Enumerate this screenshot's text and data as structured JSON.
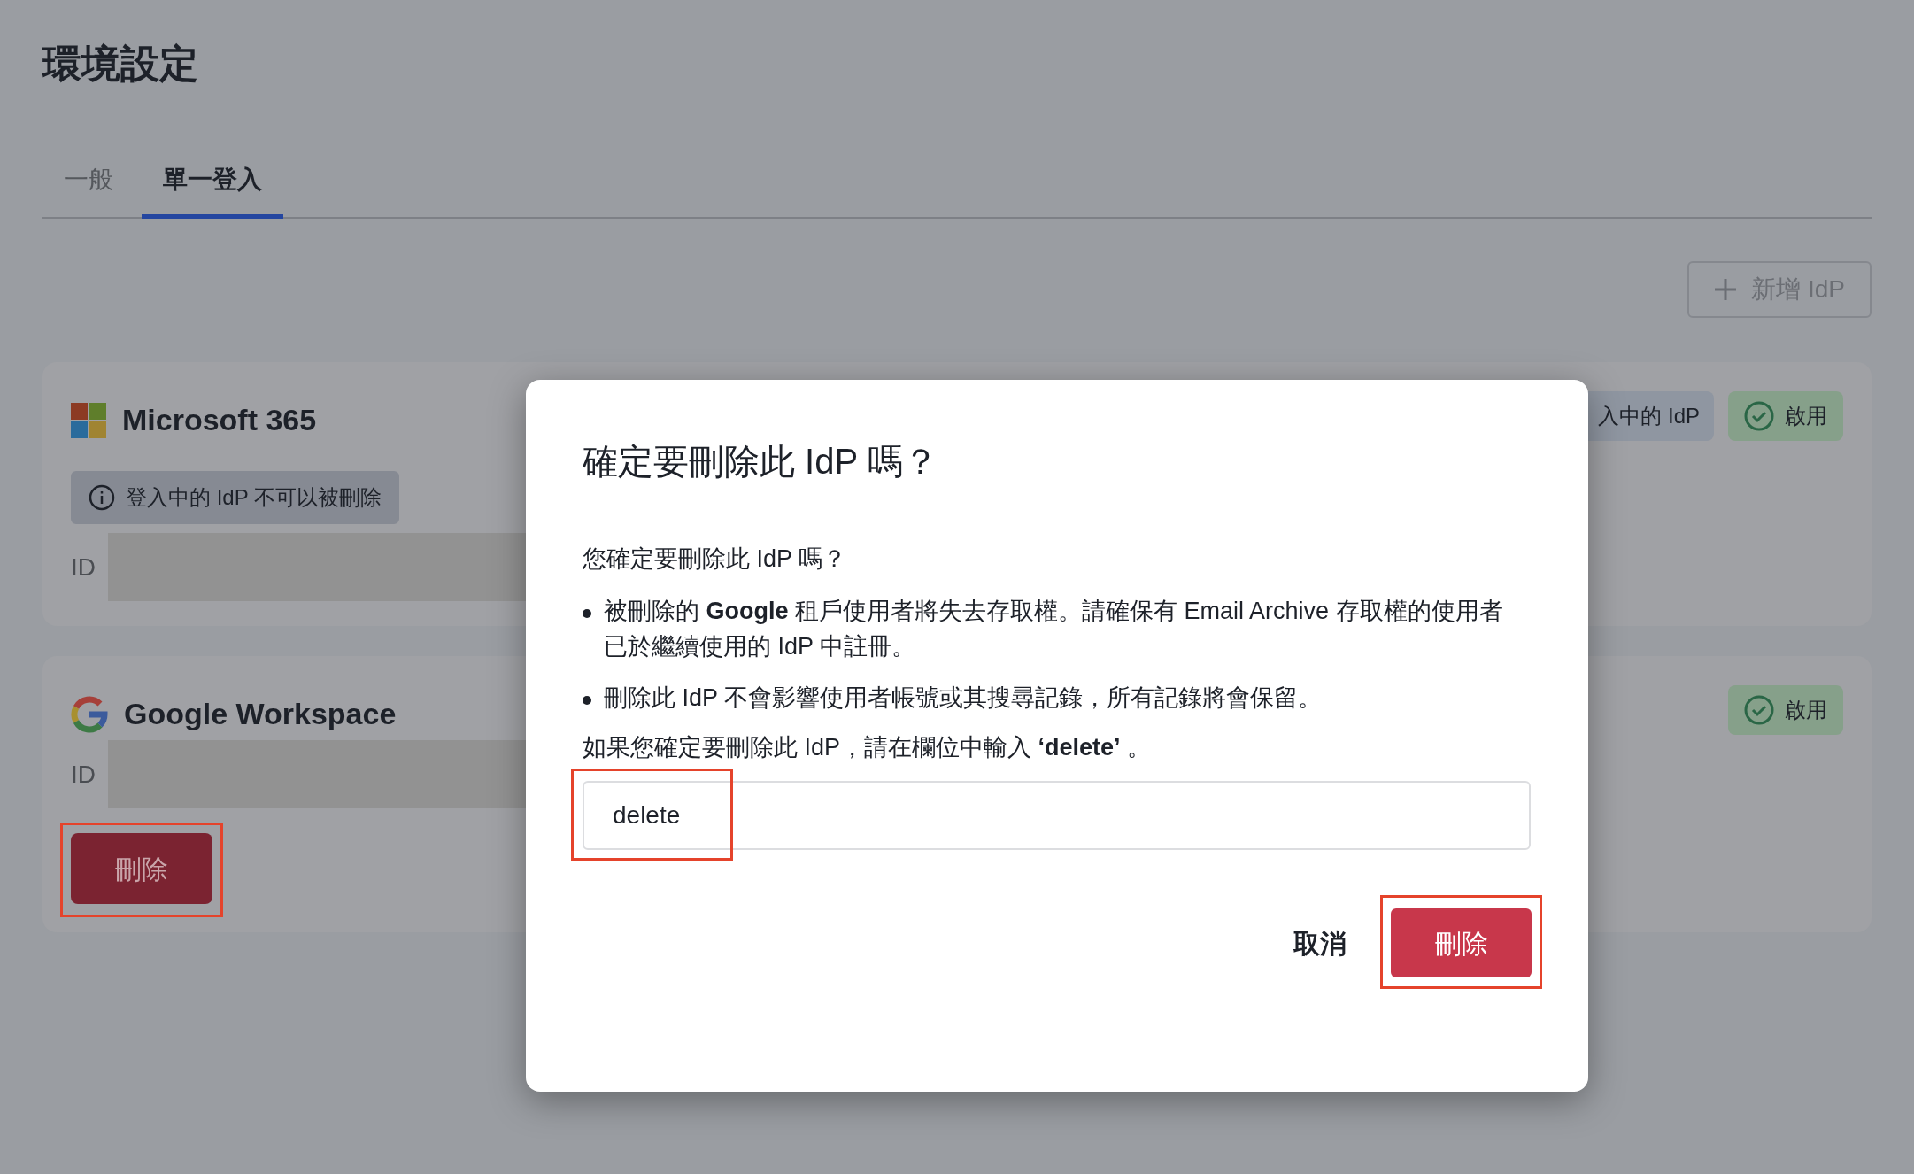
{
  "page": {
    "title": "環境設定"
  },
  "tabs": [
    {
      "label": "一般",
      "selected": false
    },
    {
      "label": "單一登入",
      "selected": true
    }
  ],
  "add_button": {
    "label": "新增 IdP"
  },
  "idps": [
    {
      "kind": "microsoft",
      "name": "Microsoft 365",
      "notice": "登入中的 IdP 不可以被刪除",
      "id_label": "ID",
      "badges": [
        {
          "kind": "current",
          "label": "入中的 IdP"
        },
        {
          "kind": "enabled",
          "label": "啟用"
        }
      ]
    },
    {
      "kind": "google",
      "name": "Google Workspace",
      "id_label": "ID",
      "delete_button": {
        "label": "刪除",
        "highlighted": true
      },
      "badges": [
        {
          "kind": "enabled",
          "label": "啟用"
        }
      ]
    }
  ],
  "dialog": {
    "title": "確定要刪除此 IdP 嗎？",
    "question": "您確定要刪除此 IdP 嗎？",
    "bullets": [
      "被刪除的 **Google** 租戶使用者將失去存取權。請確保有 Email Archive 存取權的使用者已於繼續使用的 IdP 中註冊。",
      "刪除此 IdP 不會影響使用者帳號或其搜尋記錄，所有記錄將會保留。"
    ],
    "instruction": "如果您確定要刪除此 IdP，請在欄位中輸入 **‘delete’** 。",
    "input": {
      "value": "delete",
      "highlighted": true
    },
    "cancel_button": {
      "label": "取消"
    },
    "confirm_button": {
      "label": "刪除",
      "highlighted": true
    }
  }
}
